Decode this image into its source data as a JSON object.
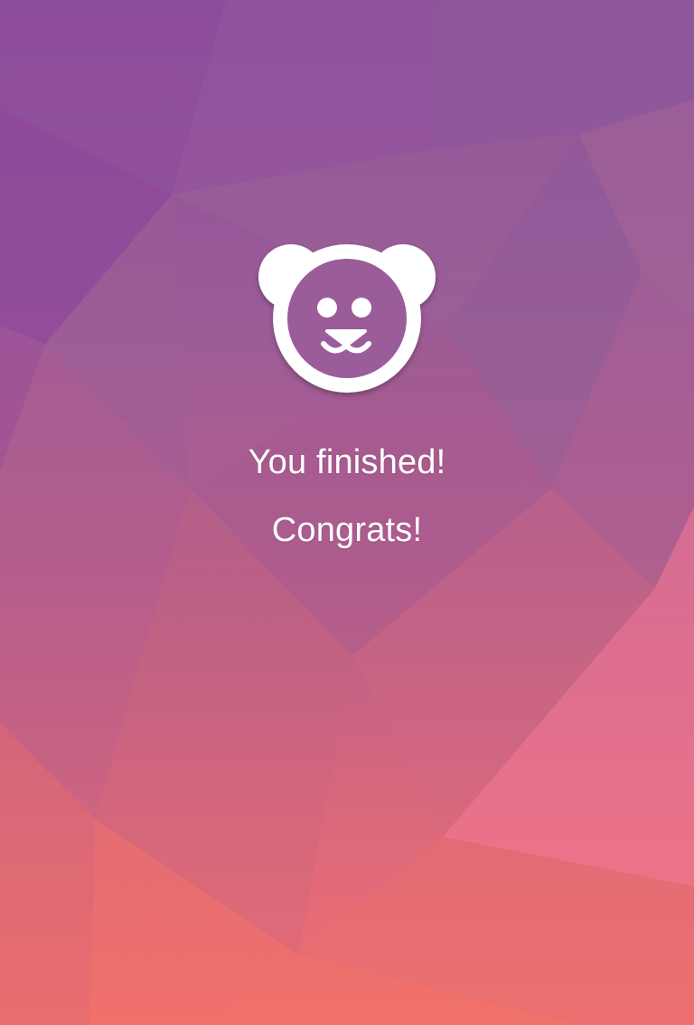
{
  "screen": {
    "message_primary": "You finished!",
    "message_secondary": "Congrats!"
  },
  "logo": {
    "icon": "bear-face-icon",
    "color": "#ffffff"
  },
  "colors": {
    "background_top": "#8f4f9c",
    "background_bottom": "#f27070",
    "text": "#ffffff"
  }
}
